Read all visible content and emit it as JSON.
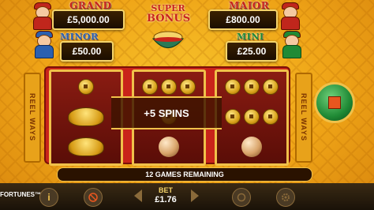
{
  "jackpots": {
    "grand": {
      "title": "GRAND",
      "value": "£5,000.00"
    },
    "major": {
      "title": "MAJOR",
      "value": "£800.00"
    },
    "minor": {
      "title": "MINOR",
      "value": "£50.00"
    },
    "mini": {
      "title": "MINI",
      "value": "£25.00"
    }
  },
  "logo": {
    "line1": "SUPER",
    "line2": "BONUS"
  },
  "side_panels": {
    "left": "REEL WAYS",
    "right": "REEL WAYS"
  },
  "banner": {
    "text": "+5 SPINS"
  },
  "games_remaining": {
    "text": "12 GAMES REMAINING"
  },
  "toolbar": {
    "brand": "FORTUNES™",
    "info_icon": "i",
    "bet_label": "BET",
    "bet_value": "£1.76"
  },
  "colors": {
    "gold": "#f0c14a",
    "red": "#c9241a",
    "green": "#1f8a35",
    "dark": "#2a1200"
  }
}
